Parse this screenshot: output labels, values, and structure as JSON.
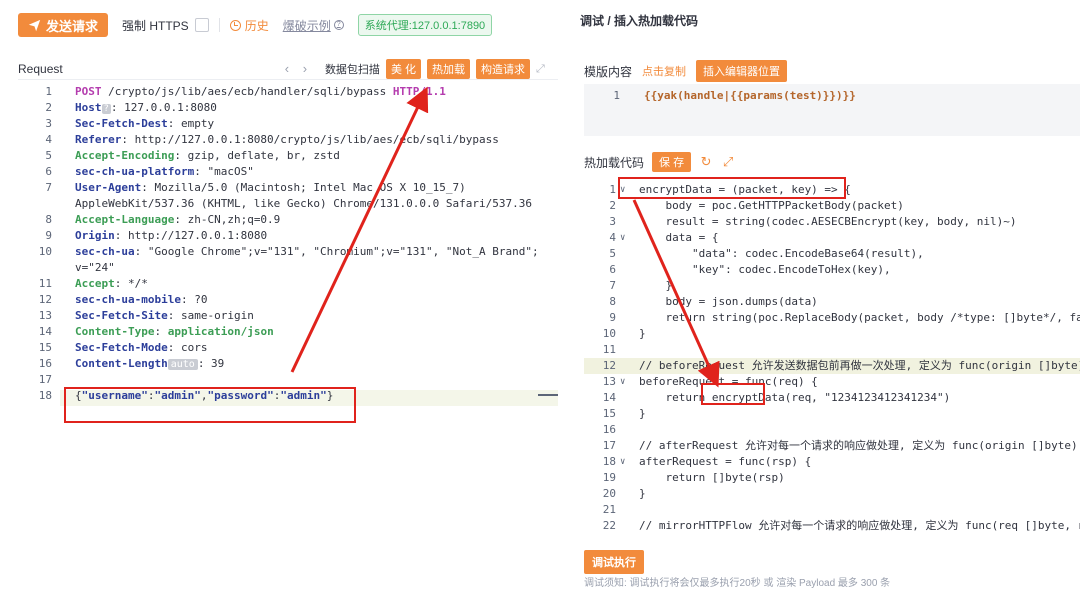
{
  "toolbar": {
    "send_label": "发送请求",
    "https_label": "强制 HTTPS",
    "history_label": "历史",
    "example_label": "爆破示例",
    "proxy_label": "系统代理:127.0.0.1:7890"
  },
  "request": {
    "title": "Request",
    "scan_label": "数据包扫描",
    "buttons": [
      "美 化",
      "热加载",
      "构造请求"
    ],
    "lines": [
      {
        "n": "1",
        "parts": [
          [
            "m",
            "POST"
          ],
          [
            "v",
            " /crypto/js/lib/aes/ecb/handler/sqli/bypass "
          ],
          [
            "m",
            "HTTP/1.1"
          ]
        ]
      },
      {
        "n": "2",
        "parts": [
          [
            "h",
            "Host"
          ],
          [
            "q",
            "?"
          ],
          [
            "v",
            ": 127.0.0.1:8080"
          ]
        ]
      },
      {
        "n": "3",
        "parts": [
          [
            "h",
            "Sec-Fetch-Dest"
          ],
          [
            "v",
            ": empty"
          ]
        ]
      },
      {
        "n": "4",
        "parts": [
          [
            "h",
            "Referer"
          ],
          [
            "v",
            ": http://127.0.0.1:8080/crypto/js/lib/aes/ecb/sqli/bypass"
          ]
        ]
      },
      {
        "n": "5",
        "parts": [
          [
            "g",
            "Accept-Encoding"
          ],
          [
            "v",
            ": gzip, deflate, br, zstd"
          ]
        ]
      },
      {
        "n": "6",
        "parts": [
          [
            "h",
            "sec-ch-ua-platform"
          ],
          [
            "v",
            ": \"macOS\""
          ]
        ]
      },
      {
        "n": "7",
        "parts": [
          [
            "h",
            "User-Agent"
          ],
          [
            "v",
            ": Mozilla/5.0 (Macintosh; Intel Mac OS X 10_15_7)"
          ]
        ]
      },
      {
        "n": "",
        "parts": [
          [
            "v",
            "AppleWebKit/537.36 (KHTML, like Gecko) Chrome/131.0.0.0 Safari/537.36"
          ]
        ]
      },
      {
        "n": "8",
        "parts": [
          [
            "g",
            "Accept-Language"
          ],
          [
            "v",
            ": zh-CN,zh;q=0.9"
          ]
        ]
      },
      {
        "n": "9",
        "parts": [
          [
            "h",
            "Origin"
          ],
          [
            "v",
            ": http://127.0.0.1:8080"
          ]
        ]
      },
      {
        "n": "10",
        "parts": [
          [
            "h",
            "sec-ch-ua"
          ],
          [
            "v",
            ": \"Google Chrome\";v=\"131\", \"Chromium\";v=\"131\", \"Not_A Brand\";"
          ]
        ]
      },
      {
        "n": "",
        "parts": [
          [
            "v",
            "v=\"24\""
          ]
        ]
      },
      {
        "n": "11",
        "parts": [
          [
            "g",
            "Accept"
          ],
          [
            "v",
            ": */*"
          ]
        ]
      },
      {
        "n": "12",
        "parts": [
          [
            "h",
            "sec-ch-ua-mobile"
          ],
          [
            "v",
            ": ?0"
          ]
        ]
      },
      {
        "n": "13",
        "parts": [
          [
            "h",
            "Sec-Fetch-Site"
          ],
          [
            "v",
            ": same-origin"
          ]
        ]
      },
      {
        "n": "14",
        "parts": [
          [
            "g",
            "Content-Type"
          ],
          [
            "v",
            ": "
          ],
          [
            "g",
            "application/json"
          ]
        ]
      },
      {
        "n": "15",
        "parts": [
          [
            "h",
            "Sec-Fetch-Mode"
          ],
          [
            "v",
            ": cors"
          ]
        ]
      },
      {
        "n": "16",
        "parts": [
          [
            "h",
            "Content-Length"
          ],
          [
            "a",
            "auto"
          ],
          [
            "v",
            ": 39"
          ]
        ]
      },
      {
        "n": "17",
        "parts": []
      },
      {
        "n": "18",
        "parts": [
          [
            "v",
            "{"
          ],
          [
            "s",
            "\"username\""
          ],
          [
            "v",
            ":"
          ],
          [
            "s",
            "\"admin\""
          ],
          [
            "v",
            ","
          ],
          [
            "s",
            "\"password\""
          ],
          [
            "v",
            ":"
          ],
          [
            "s",
            "\"admin\""
          ],
          [
            "v",
            "}"
          ]
        ]
      }
    ]
  },
  "right": {
    "title": "调试 / 插入热加载代码",
    "template_label": "模版内容",
    "copy_label": "点击复制",
    "insert_label": "插入编辑器位置",
    "template_line_no": "1",
    "template_code": "{{yak(handle|{{params(test)}})}}",
    "hot_label": "热加载代码",
    "save_label": "保 存",
    "code_lines": [
      {
        "n": "1",
        "fold": "∨",
        "t": "encryptData = (packet, key) => {"
      },
      {
        "n": "2",
        "fold": "",
        "t": "    body = poc.GetHTTPPacketBody(packet)"
      },
      {
        "n": "3",
        "fold": "",
        "t": "    result = string(codec.AESECBEncrypt(key, body, nil)~)"
      },
      {
        "n": "4",
        "fold": "∨",
        "t": "    data = {"
      },
      {
        "n": "5",
        "fold": "",
        "t": "        \"data\": codec.EncodeBase64(result),"
      },
      {
        "n": "6",
        "fold": "",
        "t": "        \"key\": codec.EncodeToHex(key),"
      },
      {
        "n": "7",
        "fold": "",
        "t": "    }"
      },
      {
        "n": "8",
        "fold": "",
        "t": "    body = json.dumps(data)"
      },
      {
        "n": "9",
        "fold": "",
        "t": "    return string(poc.ReplaceBody(packet, body /*type: []byte*/, false"
      },
      {
        "n": "10",
        "fold": "",
        "t": "}"
      },
      {
        "n": "11",
        "fold": "",
        "t": ""
      },
      {
        "n": "12",
        "fold": "",
        "t": "// beforeRequest 允许发送数据包前再做一次处理, 定义为 func(origin []byte) []"
      },
      {
        "n": "13",
        "fold": "∨",
        "t": "beforeRequest = func(req) {"
      },
      {
        "n": "14",
        "fold": "",
        "t": "    return encryptData(req, \"1234123412341234\")"
      },
      {
        "n": "15",
        "fold": "",
        "t": "}"
      },
      {
        "n": "16",
        "fold": "",
        "t": ""
      },
      {
        "n": "17",
        "fold": "",
        "t": "// afterRequest 允许对每一个请求的响应做处理, 定义为 func(origin []byte) []b"
      },
      {
        "n": "18",
        "fold": "∨",
        "t": "afterRequest = func(rsp) {"
      },
      {
        "n": "19",
        "fold": "",
        "t": "    return []byte(rsp)"
      },
      {
        "n": "20",
        "fold": "",
        "t": "}"
      },
      {
        "n": "21",
        "fold": "",
        "t": ""
      },
      {
        "n": "22",
        "fold": "",
        "t": "// mirrorHTTPFlow 允许对每一个请求的响应做处理, 定义为 func(req []byte, rsp"
      }
    ],
    "debug_label": "调试执行",
    "debug_note": "调试须知: 调试执行将会仅最多执行20秒 或 渲染 Payload 最多 300 条"
  },
  "colors": {
    "accent": "#f28b3c",
    "annotation_red": "#e0231c",
    "proxy_green": "#2ea957"
  },
  "icons": {
    "send": "paper-plane-icon",
    "history": "clock-icon",
    "example": "question-circle-icon",
    "refresh": "refresh-icon",
    "fullscreen": "expand-icon"
  }
}
